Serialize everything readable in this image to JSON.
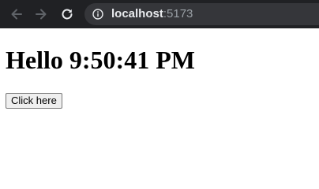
{
  "browser": {
    "url_host": "localhost",
    "url_port": ":5173",
    "icons": {
      "back": "arrow-left-icon",
      "forward": "arrow-right-icon",
      "reload": "reload-icon",
      "site_info": "info-icon"
    }
  },
  "page": {
    "heading": "Hello 9:50:41 PM",
    "button_label": "Click here"
  }
}
